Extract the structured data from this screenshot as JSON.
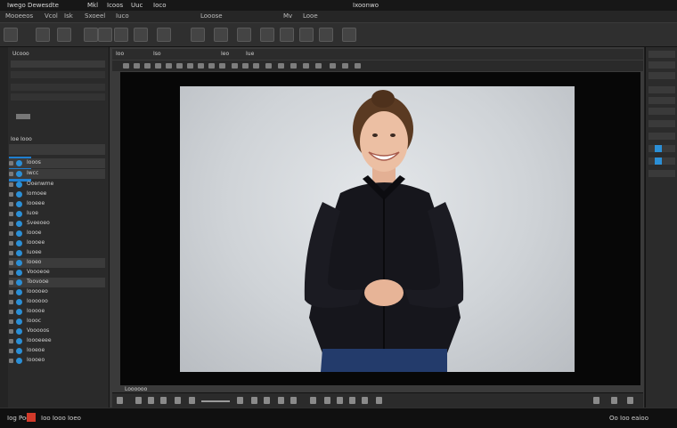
{
  "menubar": {
    "items": [
      "Iwego Dewesdte",
      "Mkl",
      "Icoos",
      "Uuc",
      "Ioco"
    ],
    "right": "Ixoonwo"
  },
  "titlebar": {
    "items": [
      "Mooeeos",
      "Vcol",
      "Isk",
      "Sxoeel",
      "Iuco",
      "Looose",
      "Mv",
      "Looe"
    ]
  },
  "leftpanel": {
    "header": "Ucooo",
    "section_label": "Ioe Iooo",
    "layers": [
      "Iooos",
      "Iwcc",
      "Ooenwme",
      "Iomoee",
      "Iooeee",
      "Iuoe",
      "Sveeoeo",
      "Ioooe",
      "Ioooee",
      "Iuoee",
      "Iooeo",
      "Voooeoe",
      "Toovooe",
      "Iooooeo",
      "Ioooooo",
      "Iooooe",
      "Ioooc",
      "Vooooos",
      "Ioooeeee",
      "Iooeoe",
      "Ioooeo"
    ]
  },
  "docbar": {
    "tabs": [
      "Ioo",
      "Iso",
      "Ieo",
      "Iue"
    ]
  },
  "statusbar": {
    "left": "Loooooo"
  },
  "taskbar": {
    "app": "Iog Poo",
    "items": [
      "Ioo Iooo Ioeo"
    ],
    "right": "Oo  Ioo eaioo"
  },
  "photo": {
    "subject": "smiling woman in black blouse"
  },
  "colors": {
    "accent": "#2b8fd6",
    "background": "#1e1e1e",
    "panel": "#2a2a2a"
  }
}
